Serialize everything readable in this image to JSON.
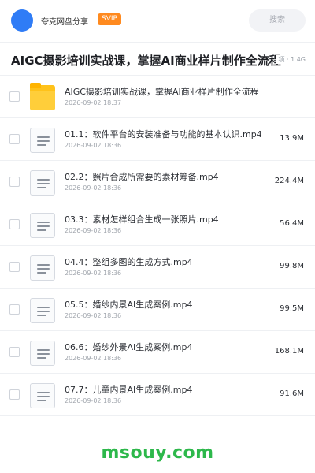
{
  "header": {
    "owner_name": "夸克网盘分享",
    "badge": "SVIP",
    "search_placeholder": "搜索"
  },
  "folder": {
    "title": "AIGC摄影培训实战课，掌握AI商业样片制作全流程",
    "meta": "项 · 1.4G"
  },
  "items": [
    {
      "type": "folder",
      "name": "AIGC摄影培训实战课，掌握AI商业样片制作全流程",
      "date": "2026-09-02 18:37",
      "size": ""
    },
    {
      "type": "file",
      "name": "01.1：软件平台的安装准备与功能的基本认识.mp4",
      "date": "2026-09-02 18:36",
      "size": "13.9M"
    },
    {
      "type": "file",
      "name": "02.2：照片合成所需要的素材筹备.mp4",
      "date": "2026-09-02 18:36",
      "size": "224.4M"
    },
    {
      "type": "file",
      "name": "03.3：素材怎样组合生成一张照片.mp4",
      "date": "2026-09-02 18:36",
      "size": "56.4M"
    },
    {
      "type": "file",
      "name": "04.4：整组多图的生成方式.mp4",
      "date": "2026-09-02 18:36",
      "size": "99.8M"
    },
    {
      "type": "file",
      "name": "05.5：婚纱内景AI生成案例.mp4",
      "date": "2026-09-02 18:36",
      "size": "99.5M"
    },
    {
      "type": "file",
      "name": "06.6：婚纱外景AI生成案例.mp4",
      "date": "2026-09-02 18:36",
      "size": "168.1M"
    },
    {
      "type": "file",
      "name": "07.7：儿童内景AI生成案例.mp4",
      "date": "2026-09-02 18:36",
      "size": "91.6M"
    }
  ],
  "watermark": "msouy.com",
  "colors": {
    "accent": "#2f7cf6",
    "badge": "#ff8a1f",
    "folder": "#ffc21a",
    "watermark": "#2db84b"
  }
}
